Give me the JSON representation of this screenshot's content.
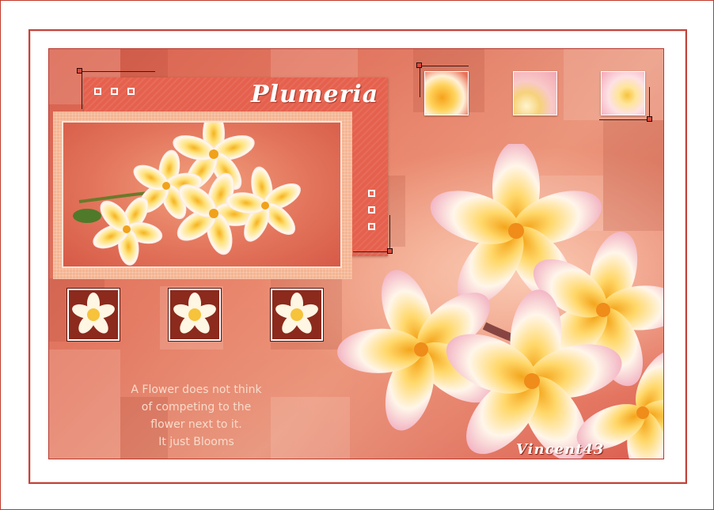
{
  "title": "Plumeria",
  "quote": {
    "lines": [
      "A Flower does not think",
      "of competing to the",
      "flower next to it.",
      "It just Blooms"
    ]
  },
  "signature": "Vincent43",
  "colors": {
    "frame_border": "#c2433a",
    "background_main": "#e37a63",
    "panel": "#e5614e",
    "thumb_bg": "#8b2a1d",
    "petal_white": "#fff8ef",
    "petal_yellow": "#f6c33a"
  },
  "icons": {
    "flower": "plumeria-flower-icon",
    "square": "square-outline-icon"
  }
}
